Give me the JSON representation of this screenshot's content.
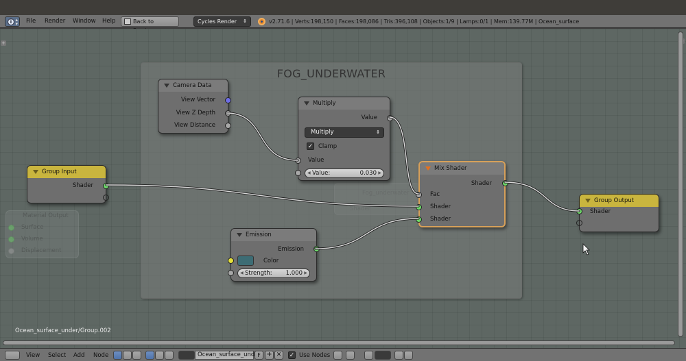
{
  "info_header": {
    "menus": [
      "File",
      "Render",
      "Window",
      "Help"
    ],
    "back_button": "Back to Previous",
    "render_engine": "Cycles Render",
    "stats": "v2.71.6 | Verts:198,150 | Faces:198,086 | Tris:396,108 | Objects:1/9 | Lamps:0/1 | Mem:139.77M | Ocean_surface"
  },
  "node_editor": {
    "frame_label": "FOG_UNDERWATER",
    "path": "Ocean_surface_under/Group.002",
    "nodes": {
      "camera_data": {
        "title": "Camera Data",
        "outputs": [
          "View Vector",
          "View Z Depth",
          "View Distance"
        ]
      },
      "multiply": {
        "title": "Multiply",
        "output": "Value",
        "operation": "Multiply",
        "clamp_label": "Clamp",
        "clamp_checked": true,
        "input_label": "Value",
        "value_field_label": "Value:",
        "value_field_value": "0.030"
      },
      "mix_shader": {
        "title": "Mix Shader",
        "output": "Shader",
        "inputs": [
          "Fac",
          "Shader",
          "Shader"
        ]
      },
      "group_input": {
        "title": "Group Input",
        "output": "Shader"
      },
      "group_output": {
        "title": "Group Output",
        "input": "Shader"
      },
      "emission": {
        "title": "Emission",
        "output": "Emission",
        "color_label": "Color",
        "color_value": "#3d6c74",
        "strength_label": "Strength:",
        "strength_value": "1.000"
      },
      "ghost_material_output": {
        "title": "Material Output",
        "inputs": [
          "Surface",
          "Volume",
          "Displacement"
        ]
      },
      "ghost_material_slot": {
        "name": "Fog_underwater",
        "socket": "Shader"
      }
    }
  },
  "footer": {
    "menus": [
      "View",
      "Select",
      "Add",
      "Node"
    ],
    "material_name": "Ocean_surface_under",
    "fake_user": "F",
    "use_nodes_label": "Use Nodes",
    "use_nodes_checked": true
  }
}
